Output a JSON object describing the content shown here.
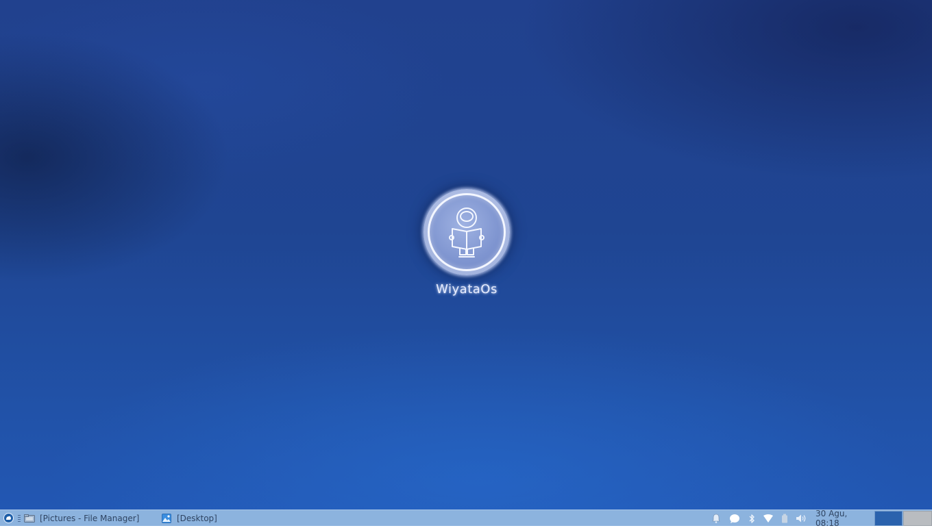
{
  "desktop": {
    "brand_name": "WiyataOs"
  },
  "taskbar": {
    "menu_icon": "whisker-menu-icon",
    "tasks": [
      {
        "icon": "file-manager-icon",
        "label": "[Pictures - File Manager]"
      },
      {
        "icon": "image-viewer-icon",
        "label": "[Desktop]"
      }
    ],
    "tray_icons": [
      "notification-bell-icon",
      "chat-bubble-icon",
      "bluetooth-icon",
      "wifi-icon",
      "battery-icon",
      "volume-icon"
    ],
    "clock": "30 Agu, 08:18",
    "workspaces": [
      "workspace-1",
      "workspace-2"
    ],
    "active_workspace_color": "#2a62ad"
  },
  "colors": {
    "taskbar_bg": "#8cb3de",
    "desktop_bg": "#1f4592"
  }
}
